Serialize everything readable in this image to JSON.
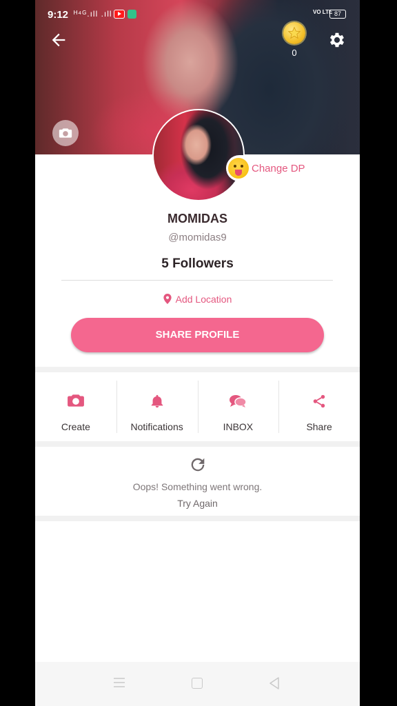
{
  "status_bar": {
    "time": "9:12",
    "signal": "ᴴ⁴ᴳ.ıll .ıll",
    "volte": "VO LTE",
    "battery": "87"
  },
  "header": {
    "coin_count": "0"
  },
  "profile": {
    "change_dp_label": "Change DP",
    "name": "MOMIDAS",
    "handle": "@momidas9",
    "followers": "5 Followers",
    "add_location": "Add Location",
    "share_profile_label": "SHARE PROFILE"
  },
  "actions": [
    {
      "label": "Create",
      "icon": "camera-icon"
    },
    {
      "label": "Notifications",
      "icon": "bell-icon"
    },
    {
      "label": "INBOX",
      "icon": "chat-icon"
    },
    {
      "label": "Share",
      "icon": "share-icon"
    }
  ],
  "error": {
    "message": "Oops! Something went wrong.",
    "retry_label": "Try Again"
  },
  "colors": {
    "accent": "#f4678f",
    "accent_text": "#e4577f"
  }
}
